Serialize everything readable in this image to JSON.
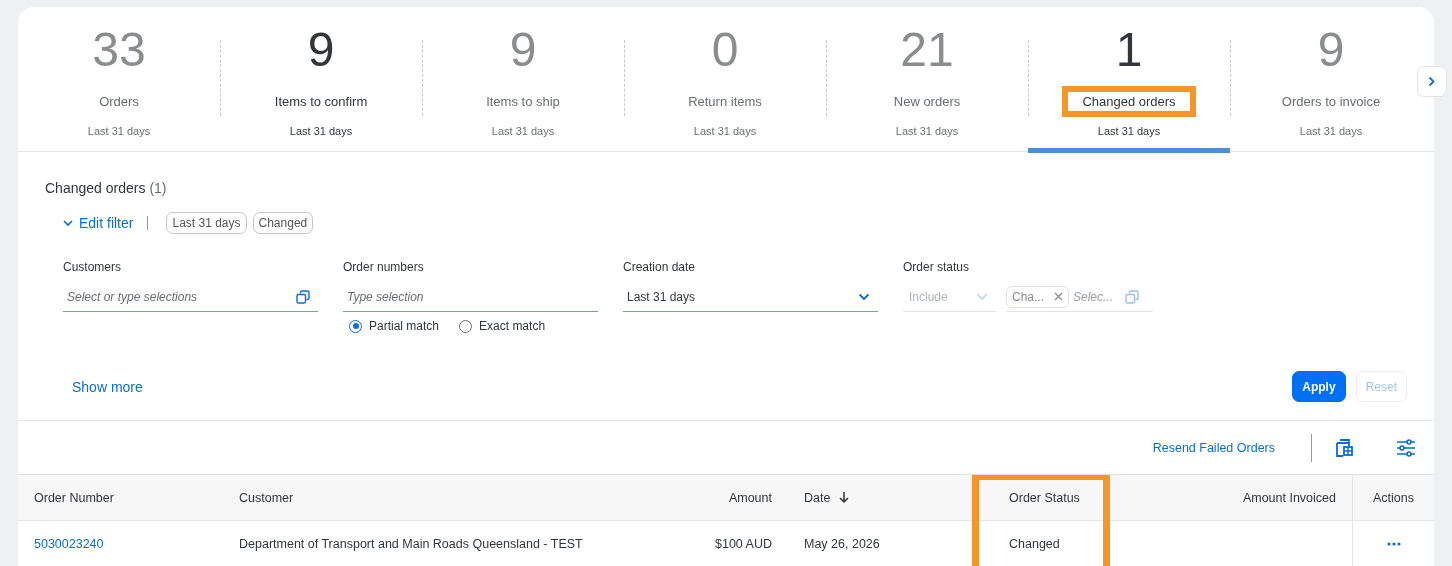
{
  "kpi_tiles": [
    {
      "value": "33",
      "label": "Orders",
      "period": "Last 31 days",
      "selected": false,
      "emphasized": false,
      "annotated": false
    },
    {
      "value": "9",
      "label": "Items to confirm",
      "period": "Last 31 days",
      "selected": false,
      "emphasized": true,
      "annotated": false
    },
    {
      "value": "9",
      "label": "Items to ship",
      "period": "Last 31 days",
      "selected": false,
      "emphasized": false,
      "annotated": false
    },
    {
      "value": "0",
      "label": "Return items",
      "period": "Last 31 days",
      "selected": false,
      "emphasized": false,
      "annotated": false
    },
    {
      "value": "21",
      "label": "New orders",
      "period": "Last 31 days",
      "selected": false,
      "emphasized": false,
      "annotated": false
    },
    {
      "value": "1",
      "label": "Changed orders",
      "period": "Last 31 days",
      "selected": true,
      "emphasized": true,
      "annotated": true
    },
    {
      "value": "9",
      "label": "Orders to invoice",
      "period": "Last 31 days",
      "selected": false,
      "emphasized": false,
      "annotated": false
    }
  ],
  "filter_panel": {
    "title": "Changed orders",
    "count": "(1)",
    "edit_filter": "Edit filter",
    "expanded": true,
    "chips": [
      "Last 31 days",
      "Changed"
    ],
    "fields": [
      {
        "kind": "multi-input",
        "label": "Customers",
        "placeholder": "Select or type selections"
      },
      {
        "kind": "text-input",
        "label": "Order numbers",
        "placeholder": "Type selection",
        "options": [
          {
            "label": "Partial match",
            "selected": true
          },
          {
            "label": "Exact match",
            "selected": false
          }
        ]
      },
      {
        "kind": "select",
        "label": "Creation date",
        "value": "Last 31 days"
      },
      {
        "kind": "status",
        "label": "Order status",
        "operator": "Include",
        "token": "Cha...",
        "placeholder": "Selec..."
      }
    ],
    "show_more": "Show more",
    "buttons": [
      {
        "label": "Apply",
        "kind": "primary",
        "disabled": false
      },
      {
        "label": "Reset",
        "kind": "secondary",
        "disabled": true
      }
    ]
  },
  "toolbar": {
    "link": "Resend Failed Orders"
  },
  "table": {
    "columns": [
      {
        "label": "Order Number",
        "sorted": false,
        "annotated": false
      },
      {
        "label": "Customer",
        "sorted": false,
        "annotated": false
      },
      {
        "label": "Amount",
        "sorted": false,
        "annotated": false
      },
      {
        "label": "Date",
        "sorted": true,
        "annotated": false
      },
      {
        "label": "Order Status",
        "sorted": false,
        "annotated": true
      },
      {
        "label": "Amount Invoiced",
        "sorted": false,
        "annotated": false
      },
      {
        "label": "Actions",
        "sorted": false,
        "annotated": false
      }
    ],
    "rows": [
      {
        "order_number": "5030023240",
        "customer": "Department of Transport and Main Roads Queensland - TEST",
        "amount": "$100 AUD",
        "date": "May 26, 2026",
        "status": "Changed"
      }
    ]
  }
}
